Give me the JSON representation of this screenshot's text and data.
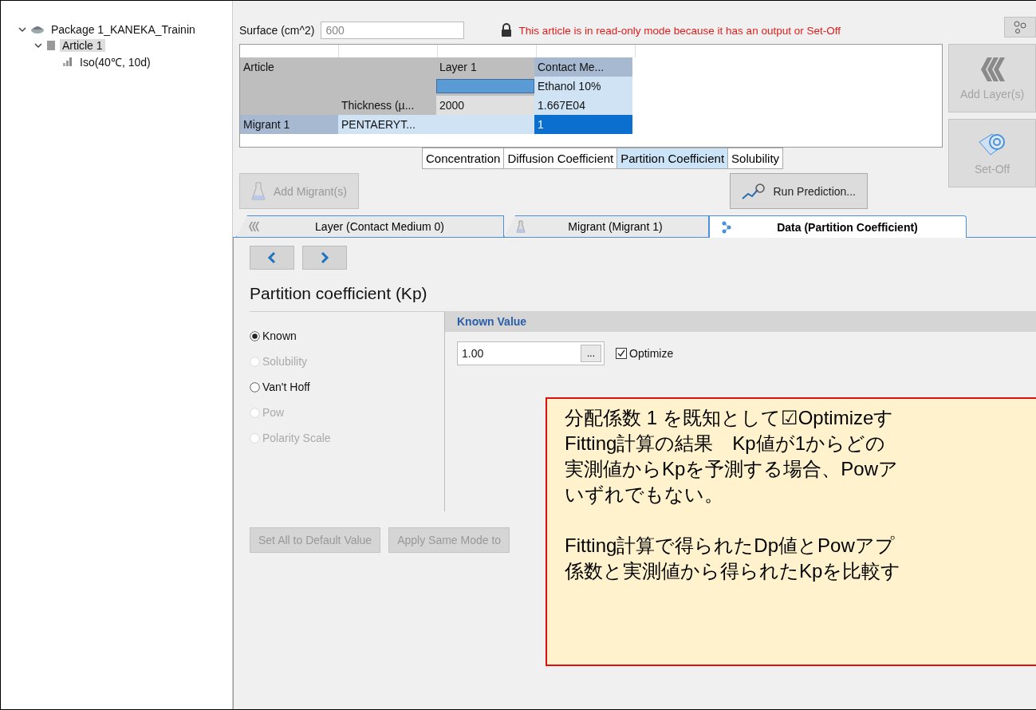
{
  "tree": [
    {
      "label": "Package 1_KANEKA_Trainin",
      "expanded": true,
      "selected": false,
      "children": [
        {
          "label": "Article 1",
          "expanded": true,
          "selected": true,
          "children": [
            {
              "label": "Iso(40℃, 10d)",
              "selected": false
            }
          ]
        }
      ]
    }
  ],
  "surface": {
    "label": "Surface (cm^2)",
    "value": "600"
  },
  "readonly_message": "This article is in read-only mode because it has an output or Set-Off",
  "grid": {
    "rows": [
      [
        {
          "kind": "grey",
          "text": "Article"
        },
        {
          "kind": "grey"
        },
        {
          "kind": "grey",
          "text": "Layer 1"
        },
        {
          "kind": "head",
          "text": "Contact Me..."
        }
      ],
      [
        {
          "kind": "grey"
        },
        {
          "kind": "grey"
        },
        {
          "kind": "swatch"
        },
        {
          "kind": "light",
          "text": "Ethanol 10%"
        }
      ],
      [
        {
          "kind": "grey"
        },
        {
          "kind": "grey",
          "text": "Thickness (µ..."
        },
        {
          "kind": "pale",
          "text": "2000"
        },
        {
          "kind": "light",
          "text": "1.667E04"
        }
      ],
      [
        {
          "kind": "head",
          "text": "Migrant 1"
        },
        {
          "kind": "light",
          "text": "PENTAERYT..."
        },
        {
          "kind": "light"
        },
        {
          "kind": "selected",
          "text": "1"
        }
      ]
    ]
  },
  "grid_tabs": [
    {
      "label": "Concentration",
      "selected": false
    },
    {
      "label": "Diffusion Coefficient",
      "selected": false
    },
    {
      "label": "Partition Coefficient",
      "selected": true
    },
    {
      "label": "Solubility",
      "selected": false
    }
  ],
  "side_buttons": [
    {
      "label": "Add Layer(s)",
      "disabled": true
    },
    {
      "label": "Set-Off",
      "disabled": true
    }
  ],
  "add_migrant": {
    "label": "Add Migrant(s)",
    "disabled": true
  },
  "run_prediction": {
    "label": "Run Prediction...",
    "disabled": false
  },
  "tabs": [
    {
      "label": "Layer (Contact Medium 0)",
      "selected": false
    },
    {
      "label": "Migrant (Migrant 1)",
      "selected": false
    },
    {
      "label": "Data (Partition Coefficient)",
      "selected": true
    }
  ],
  "section_title": "Partition coefficient (Kp)",
  "modes": [
    {
      "label": "Known",
      "selected": true,
      "disabled": false
    },
    {
      "label": "Solubility",
      "selected": false,
      "disabled": true
    },
    {
      "label": "Van't Hoff",
      "selected": false,
      "disabled": false
    },
    {
      "label": "Pow",
      "selected": false,
      "disabled": true
    },
    {
      "label": "Polarity Scale",
      "selected": false,
      "disabled": true
    }
  ],
  "known_value": {
    "title": "Known Value",
    "value": "1.00",
    "browse": "...",
    "optimize_label": "Optimize",
    "optimize": true
  },
  "bottom_buttons": [
    {
      "label": "Set All to Default Value",
      "disabled": true
    },
    {
      "label": "Apply Same Mode to",
      "disabled": true
    }
  ],
  "callout": {
    "paragraphs": [
      [
        "分配係数 1 を既知として☑Optimizeす",
        "Fitting計算の結果　Kp値が1からどの",
        "実測値からKpを予測する場合、Powア",
        "いずれでもない。"
      ],
      [
        "Fitting計算で得られたDp値とPowアプ",
        "係数と実測値から得られたKpを比較す"
      ]
    ]
  }
}
